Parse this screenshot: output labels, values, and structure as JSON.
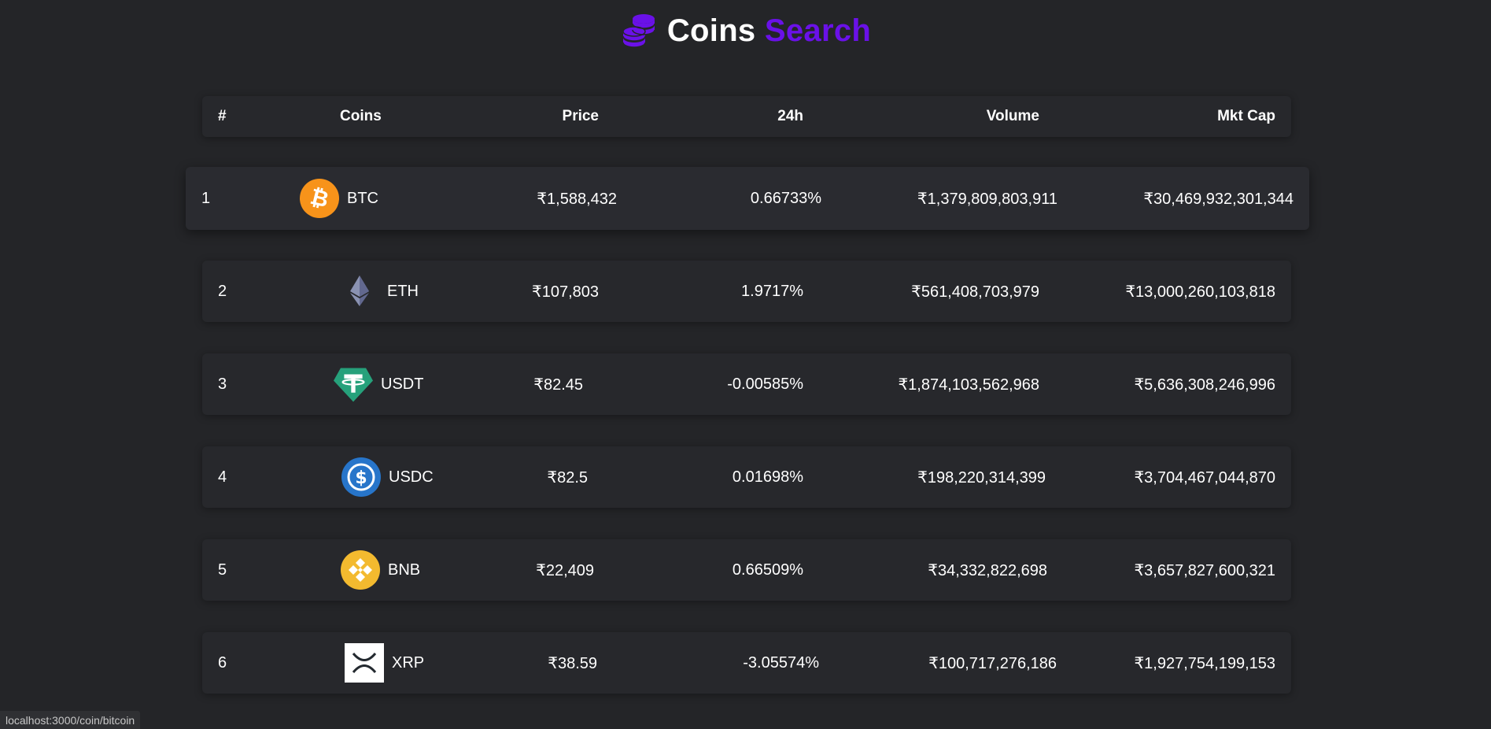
{
  "header": {
    "title_main": "Coins",
    "title_accent": "Search",
    "icon": "coins-stack-icon",
    "accent_color": "#6a11e8"
  },
  "table": {
    "columns": [
      "#",
      "Coins",
      "Price",
      "24h",
      "Volume",
      "Mkt Cap"
    ],
    "rows": [
      {
        "rank": "1",
        "symbol": "BTC",
        "icon": "bitcoin-icon",
        "price": "₹1,588,432",
        "change": "0.66733%",
        "volume": "₹1,379,809,803,911",
        "mcap": "₹30,469,932,301,344",
        "hovered": true
      },
      {
        "rank": "2",
        "symbol": "ETH",
        "icon": "ethereum-icon",
        "price": "₹107,803",
        "change": "1.9717%",
        "volume": "₹561,408,703,979",
        "mcap": "₹13,000,260,103,818",
        "hovered": false
      },
      {
        "rank": "3",
        "symbol": "USDT",
        "icon": "tether-icon",
        "price": "₹82.45",
        "change": "-0.00585%",
        "volume": "₹1,874,103,562,968",
        "mcap": "₹5,636,308,246,996",
        "hovered": false
      },
      {
        "rank": "4",
        "symbol": "USDC",
        "icon": "usd-coin-icon",
        "price": "₹82.5",
        "change": "0.01698%",
        "volume": "₹198,220,314,399",
        "mcap": "₹3,704,467,044,870",
        "hovered": false
      },
      {
        "rank": "5",
        "symbol": "BNB",
        "icon": "bnb-icon",
        "price": "₹22,409",
        "change": "0.66509%",
        "volume": "₹34,332,822,698",
        "mcap": "₹3,657,827,600,321",
        "hovered": false
      },
      {
        "rank": "6",
        "symbol": "XRP",
        "icon": "xrp-icon",
        "price": "₹38.59",
        "change": "-3.05574%",
        "volume": "₹100,717,276,186",
        "mcap": "₹1,927,754,199,153",
        "hovered": false
      }
    ]
  },
  "statusbar": {
    "url": "localhost:3000/coin/bitcoin"
  }
}
